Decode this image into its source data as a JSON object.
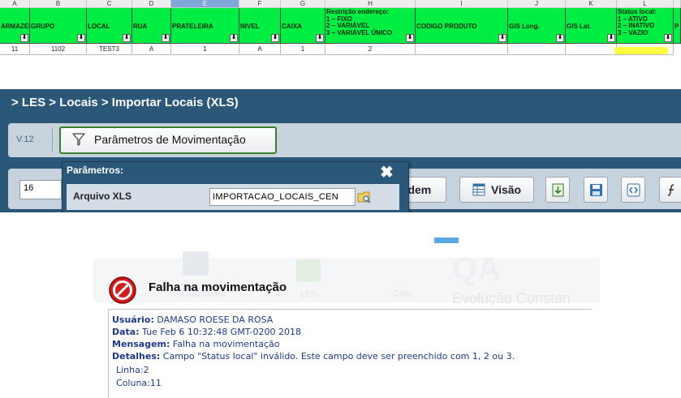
{
  "spreadsheet": {
    "columns": [
      {
        "letter": "A",
        "header": "ARMAZEM",
        "value": "11"
      },
      {
        "letter": "B",
        "header": "GRUPO",
        "value": "1102"
      },
      {
        "letter": "C",
        "header": "LOCAL",
        "value": "TEST3"
      },
      {
        "letter": "D",
        "header": "RUA",
        "value": "A"
      },
      {
        "letter": "E",
        "header": "PRATELEIRA",
        "value": "1"
      },
      {
        "letter": "F",
        "header": "NIVEL",
        "value": "A"
      },
      {
        "letter": "G",
        "header": "CAIXA",
        "value": "1"
      },
      {
        "letter": "H",
        "header_lines": [
          "Restrição endereço:",
          "1 – FIXO",
          "2 – VARIÁVEL",
          "3 – VARIÁVEL ÚNICO"
        ],
        "value": "2"
      },
      {
        "letter": "I",
        "header": "CODIGO PRODUTO",
        "value": ""
      },
      {
        "letter": "J",
        "header": "GIS Long.",
        "value": ""
      },
      {
        "letter": "K",
        "header": "GIS Lat.",
        "value": ""
      },
      {
        "letter": "L",
        "header_lines": [
          "Status local:",
          "1 – ATIVO",
          "2 – INATIVO",
          "3 – VAZIO"
        ],
        "value": ""
      },
      {
        "letter": "",
        "header": "P",
        "value": ""
      }
    ],
    "filter_glyph": "⬇",
    "highlight_color": "#ffff2a"
  },
  "app": {
    "breadcrumb": "> LES > Locais > Importar Locais (XLS)",
    "version": "V.12",
    "params_button": "Parâmetros de Movimentação",
    "number_input": "16",
    "ordem_label": "rdem",
    "visao_label": "Visão",
    "popup": {
      "title": "Parâmetros:",
      "close": "✖",
      "file_label": "Arquivo XLS",
      "file_value": "IMPORTACAO_LOCAIS_CEN"
    },
    "colors": {
      "header_blue": "#2b5778",
      "sheet_green": "#00ee44"
    }
  },
  "ghost_bg": {
    "dashboard": "Dashboard",
    "les": "LES",
    "crite": "Crite",
    "brand": "QA",
    "slogan": "Evolução Constan"
  },
  "dialog": {
    "title": "Falha na movimentação",
    "user_label": "Usuário:",
    "user_value": "DAMASO ROESE DA ROSA",
    "date_label": "Data:",
    "date_value": "Tue Feb 6 10:32:48 GMT-0200 2018",
    "msg_label": "Mensagem:",
    "msg_value": "Falha na movimentação",
    "details_label": "Detalhes:",
    "details_value": "Campo \"Status local\" inválido. Este campo deve ser preenchido com 1, 2 ou 3.",
    "line": "Linha:2",
    "column": "Coluna:11"
  }
}
